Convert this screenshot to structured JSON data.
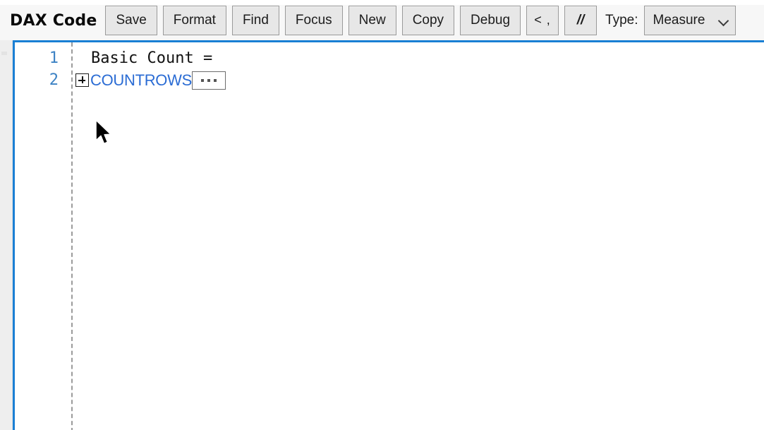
{
  "toolbar": {
    "title": "DAX Code",
    "buttons": [
      {
        "label": "Save",
        "name": "save-button"
      },
      {
        "label": "Format",
        "name": "format-button"
      },
      {
        "label": "Find",
        "name": "find-button"
      },
      {
        "label": "Focus",
        "name": "focus-button"
      },
      {
        "label": "New",
        "name": "new-button"
      },
      {
        "label": "Copy",
        "name": "copy-button"
      },
      {
        "label": "Debug",
        "name": "debug-button"
      },
      {
        "label": "< ,",
        "name": "less-comma-button"
      },
      {
        "label": "//",
        "name": "comment-button"
      }
    ],
    "type_label": "Type:",
    "type_selected": "Measure",
    "type_chevron_icon": "chevron-down-icon"
  },
  "editor": {
    "accent_color": "#1a7fd4",
    "linenumber_color": "#3c82c4",
    "keyword_color": "#2b6cd4",
    "lines": [
      {
        "number": "1",
        "indent": "  ",
        "text": "Basic Count ="
      },
      {
        "number": "2",
        "fold_icon": "plus-fold-icon",
        "function_name": "COUNTROWS",
        "collapsed_text": "..."
      }
    ]
  },
  "cursor": {
    "icon": "mouse-arrow-pointer"
  }
}
